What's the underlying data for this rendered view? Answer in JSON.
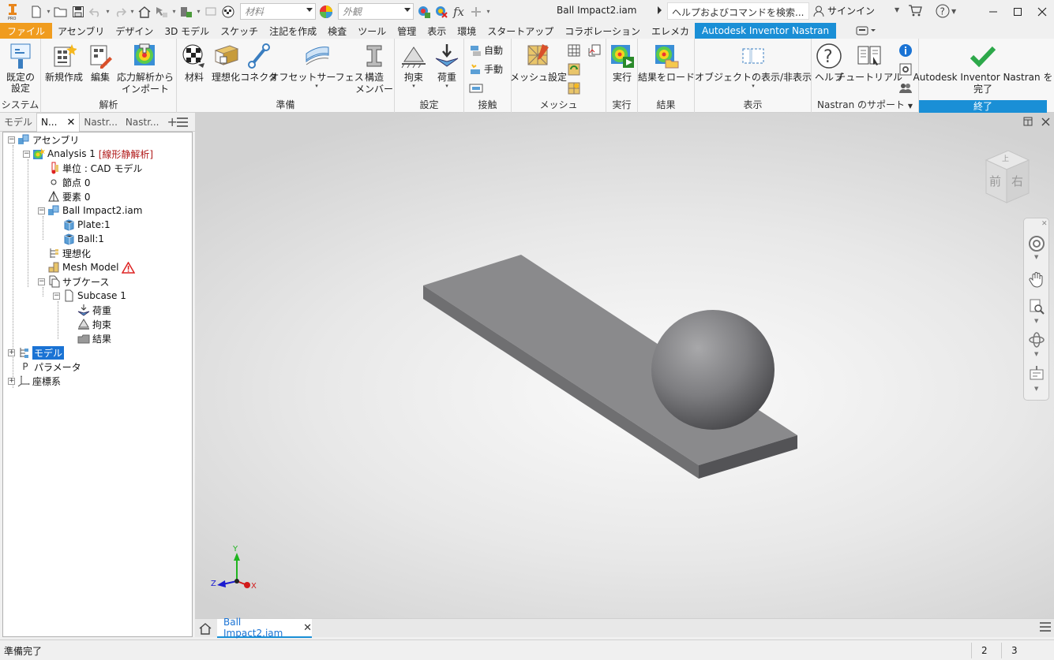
{
  "app": {
    "title": "Ball Impact2.iam",
    "search_placeholder": "ヘルプおよびコマンドを検索...",
    "signin": "サインイン",
    "material_placeholder": "材料",
    "appearance_placeholder": "外観",
    "accent_color": "#1a8fd6",
    "file_color": "#f09c1e"
  },
  "tabs": [
    {
      "label": "ファイル"
    },
    {
      "label": "アセンブリ"
    },
    {
      "label": "デザイン"
    },
    {
      "label": "3D モデル"
    },
    {
      "label": "スケッチ"
    },
    {
      "label": "注記を作成"
    },
    {
      "label": "検査"
    },
    {
      "label": "ツール"
    },
    {
      "label": "管理"
    },
    {
      "label": "表示"
    },
    {
      "label": "環境"
    },
    {
      "label": "スタートアップ"
    },
    {
      "label": "コラボレーション"
    },
    {
      "label": "エレメカ"
    },
    {
      "label": "Autodesk Inventor Nastran"
    }
  ],
  "ribbon": {
    "system": {
      "label": "システム",
      "default_settings": "既定の\n設定"
    },
    "analysis": {
      "label": "解析",
      "new": "新規作成",
      "edit": "編集",
      "import_line1": "応力解析から",
      "import_line2": "インポート"
    },
    "prepare": {
      "label": "準備",
      "material": "材料",
      "idealize": "理想化",
      "connector": "コネクタ",
      "offset_surface": "オフセットサーフェス",
      "structural_line1": "構造",
      "structural_line2": "メンバー"
    },
    "setup": {
      "label": "設定",
      "constraint": "拘束",
      "load": "荷重"
    },
    "contact": {
      "label": "接触",
      "auto": "自動",
      "manual": "手動"
    },
    "mesh": {
      "label": "メッシュ",
      "mesh_settings": "メッシュ設定"
    },
    "run": {
      "label": "実行",
      "run": "実行"
    },
    "results": {
      "label": "結果",
      "load_results": "結果をロード"
    },
    "display": {
      "label": "表示",
      "show_hide": "オブジェクトの表示/非表示"
    },
    "support": {
      "label": "Nastran のサポート",
      "help": "ヘルプ",
      "tutorial": "チュートリアル"
    },
    "exit": {
      "label": "終了",
      "finish_line1": "Autodesk Inventor Nastran を",
      "finish_line2": "完了"
    }
  },
  "browser": {
    "tabs": [
      "モデル",
      "N...",
      "Nastr...",
      "Nastr..."
    ],
    "tree": {
      "assembly": "アセンブリ",
      "analysis": "Analysis 1",
      "analysis_type": "[線形静解析]",
      "units": "単位 : CAD モデル",
      "nodes": "節点 0",
      "elements": "要素 0",
      "model_file": "Ball Impact2.iam",
      "plate": "Plate:1",
      "ball": "Ball:1",
      "idealization": "理想化",
      "mesh_model": "Mesh Model",
      "subcases": "サブケース",
      "subcase1": "Subcase 1",
      "load": "荷重",
      "constraint": "拘束",
      "result": "結果",
      "model": "モデル",
      "parameters": "パラメータ",
      "coord_system": "座標系"
    }
  },
  "viewcube": {
    "face_front": "前",
    "face_right": "右",
    "face_top": "上"
  },
  "triad": {
    "x": "X",
    "y": "Y",
    "z": "Z"
  },
  "document_tab": "Ball Impact2.iam",
  "status": {
    "text": "準備完了",
    "cell1": "2",
    "cell2": "3"
  }
}
